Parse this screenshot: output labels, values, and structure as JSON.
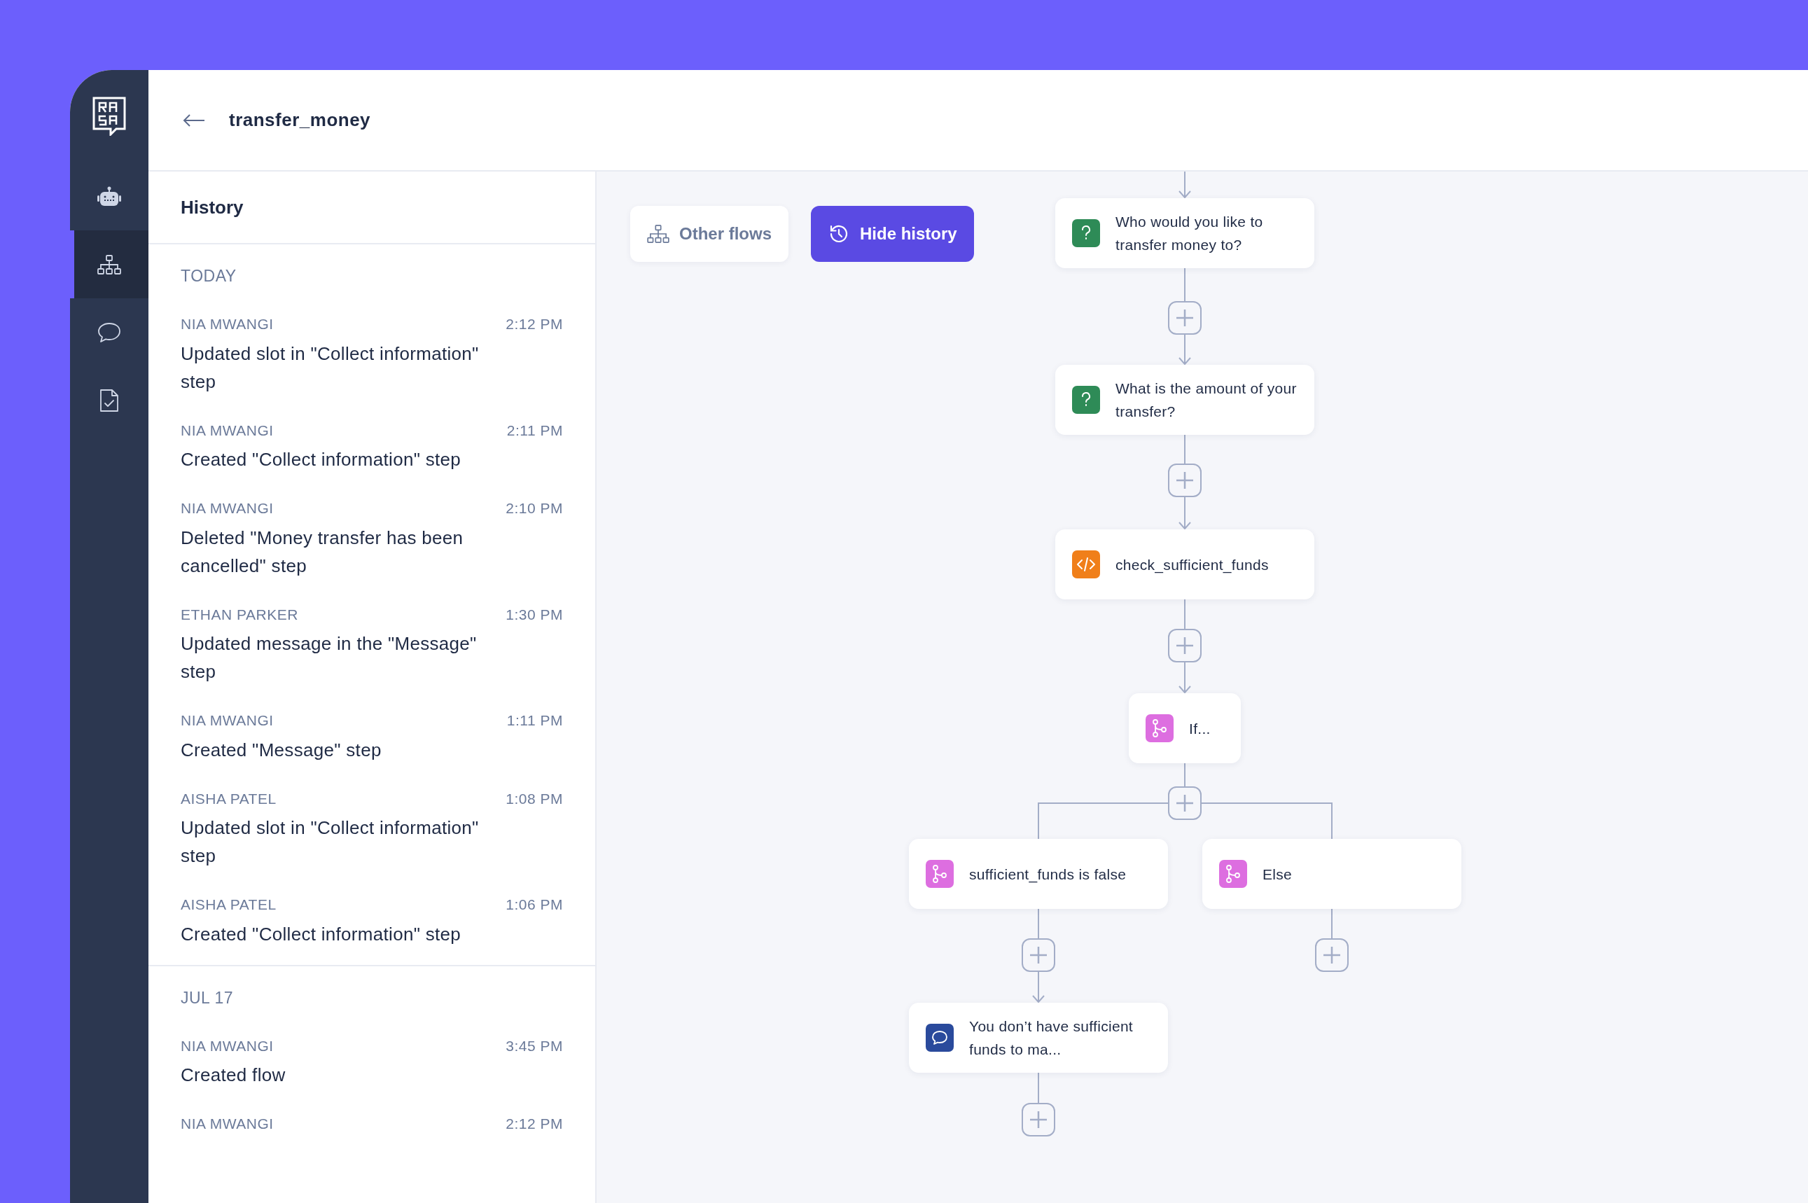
{
  "header": {
    "title": "transfer_money"
  },
  "sidebar": {
    "items": [
      {
        "selected": false
      },
      {
        "selected": true
      },
      {
        "selected": false
      },
      {
        "selected": false
      }
    ]
  },
  "history": {
    "title": "History",
    "groups": [
      {
        "label": "TODAY",
        "entries": [
          {
            "user": "NIA MWANGI",
            "time": "2:12 PM",
            "text": "Updated slot in \"Collect information\" step"
          },
          {
            "user": "NIA MWANGI",
            "time": "2:11 PM",
            "text": "Created \"Collect information\" step"
          },
          {
            "user": "NIA MWANGI",
            "time": "2:10 PM",
            "text": "Deleted \"Money transfer has been cancelled\" step"
          },
          {
            "user": "ETHAN PARKER",
            "time": "1:30 PM",
            "text": "Updated message in the \"Message\" step"
          },
          {
            "user": "NIA MWANGI",
            "time": "1:11 PM",
            "text": "Created \"Message\" step"
          },
          {
            "user": "AISHA PATEL",
            "time": "1:08 PM",
            "text": "Updated slot in \"Collect information\" step"
          },
          {
            "user": "AISHA PATEL",
            "time": "1:06 PM",
            "text": "Created \"Collect information\" step"
          }
        ]
      },
      {
        "label": "JUL 17",
        "entries": [
          {
            "user": "NIA MWANGI",
            "time": "3:45 PM",
            "text": "Created flow"
          },
          {
            "user": "NIA MWANGI",
            "time": "2:12 PM"
          }
        ]
      }
    ]
  },
  "toolbar": {
    "buttons": [
      {
        "label": "Other flows",
        "kind": "secondary"
      },
      {
        "label": "Hide history",
        "kind": "primary"
      }
    ]
  },
  "flow": {
    "nodes": [
      {
        "kind": "question",
        "text": "Who would you like to transfer money to?"
      },
      {
        "kind": "question",
        "text": "What is the amount of your transfer?"
      },
      {
        "kind": "action",
        "text": "check_sufficient_funds"
      },
      {
        "kind": "branch",
        "text": "If..."
      },
      {
        "kind": "branch",
        "text": "sufficient_funds is false"
      },
      {
        "kind": "branch",
        "text": "Else"
      },
      {
        "kind": "message",
        "text": "You don’t have sufficient funds to ma..."
      }
    ]
  }
}
